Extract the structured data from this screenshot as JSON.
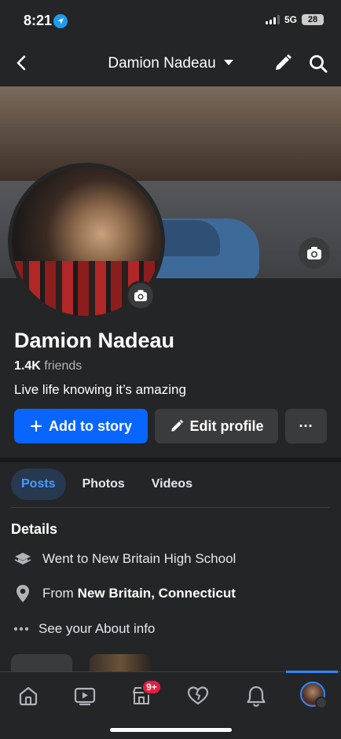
{
  "status_bar": {
    "time": "8:21",
    "network": "5G",
    "battery": "28"
  },
  "header": {
    "title": "Damion Nadeau",
    "icons": [
      "back-arrow-icon",
      "caret-down-icon",
      "pencil-icon",
      "search-icon"
    ]
  },
  "profile": {
    "name": "Damion Nadeau",
    "friends_count": "1.4K",
    "friends_label": "friends",
    "bio": "Live life knowing it’s amazing"
  },
  "actions": {
    "add_story": "Add to story",
    "edit_profile": "Edit profile",
    "more": "···"
  },
  "tabs": [
    {
      "label": "Posts",
      "active": true
    },
    {
      "label": "Photos",
      "active": false
    },
    {
      "label": "Videos",
      "active": false
    }
  ],
  "details": {
    "title": "Details",
    "school": "Went to New Britain High School",
    "from_prefix": "From",
    "from_place": "New Britain, Connecticut",
    "about_link": "See your About info"
  },
  "bottom_nav": {
    "items": [
      "home-icon",
      "video-icon",
      "marketplace-icon",
      "dating-icon",
      "notifications-icon",
      "profile-menu"
    ],
    "marketplace_badge": "9+",
    "active": "profile-menu"
  },
  "colors": {
    "background": "#242526",
    "primary_blue": "#0866ff",
    "active_tab_text": "#4a9bff",
    "badge_red": "#e41e3f"
  }
}
